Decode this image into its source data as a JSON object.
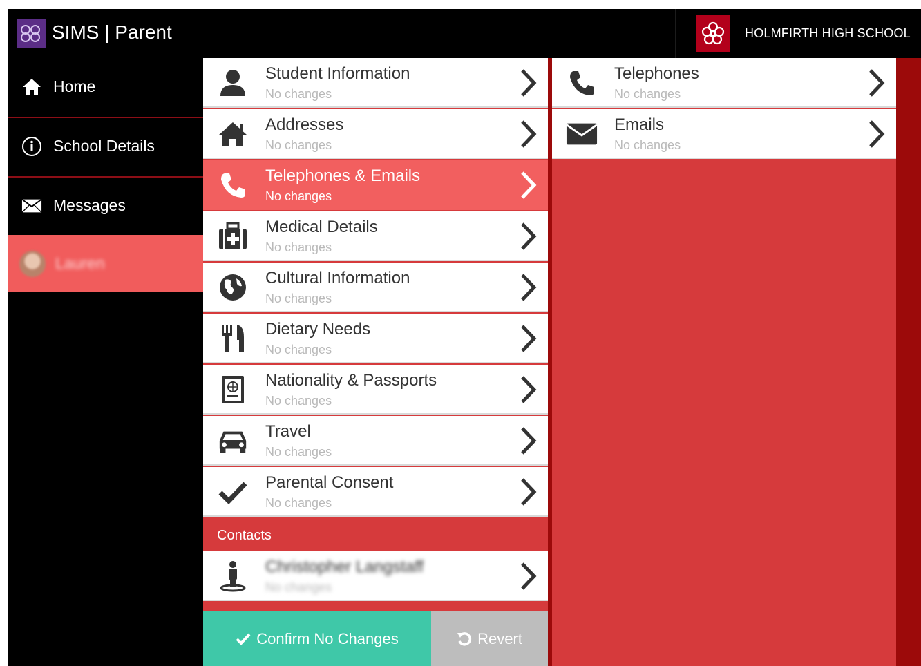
{
  "header": {
    "app_title": "SIMS | Parent",
    "school_name": "HOLMFIRTH HIGH SCHOOL"
  },
  "sidebar": {
    "items": [
      {
        "label": "Home",
        "icon": "home-icon"
      },
      {
        "label": "School Details",
        "icon": "info-icon"
      },
      {
        "label": "Messages",
        "icon": "envelope-icon"
      },
      {
        "label": "Lauren",
        "icon": "avatar"
      }
    ]
  },
  "middle": {
    "rows": [
      {
        "title": "Student Information",
        "status": "No changes",
        "icon": "person-icon"
      },
      {
        "title": "Addresses",
        "status": "No changes",
        "icon": "house-icon"
      },
      {
        "title": "Telephones & Emails",
        "status": "No changes",
        "icon": "phone-icon"
      },
      {
        "title": "Medical Details",
        "status": "No changes",
        "icon": "medical-kit-icon"
      },
      {
        "title": "Cultural Information",
        "status": "No changes",
        "icon": "globe-icon"
      },
      {
        "title": "Dietary Needs",
        "status": "No changes",
        "icon": "cutlery-icon"
      },
      {
        "title": "Nationality & Passports",
        "status": "No changes",
        "icon": "passport-icon"
      },
      {
        "title": "Travel",
        "status": "No changes",
        "icon": "car-icon"
      },
      {
        "title": "Parental Consent",
        "status": "No changes",
        "icon": "check-icon"
      }
    ],
    "contacts_header": "Contacts",
    "contact": {
      "name": "Christopher Langstaff",
      "status": "No changes",
      "icon": "contact-person-icon"
    },
    "confirm_label": "Confirm No Changes",
    "revert_label": "Revert"
  },
  "right": {
    "rows": [
      {
        "title": "Telephones",
        "status": "No changes",
        "icon": "phone-icon"
      },
      {
        "title": "Emails",
        "status": "No changes",
        "icon": "envelope-icon"
      }
    ]
  },
  "colors": {
    "accent_red": "#d63a3c",
    "selected_red": "#f25f5f",
    "dark_red": "#9c0a0a",
    "confirm_green": "#3fc8a8",
    "revert_grey": "#bdbdbd",
    "sims_purple": "#5b2d86"
  }
}
